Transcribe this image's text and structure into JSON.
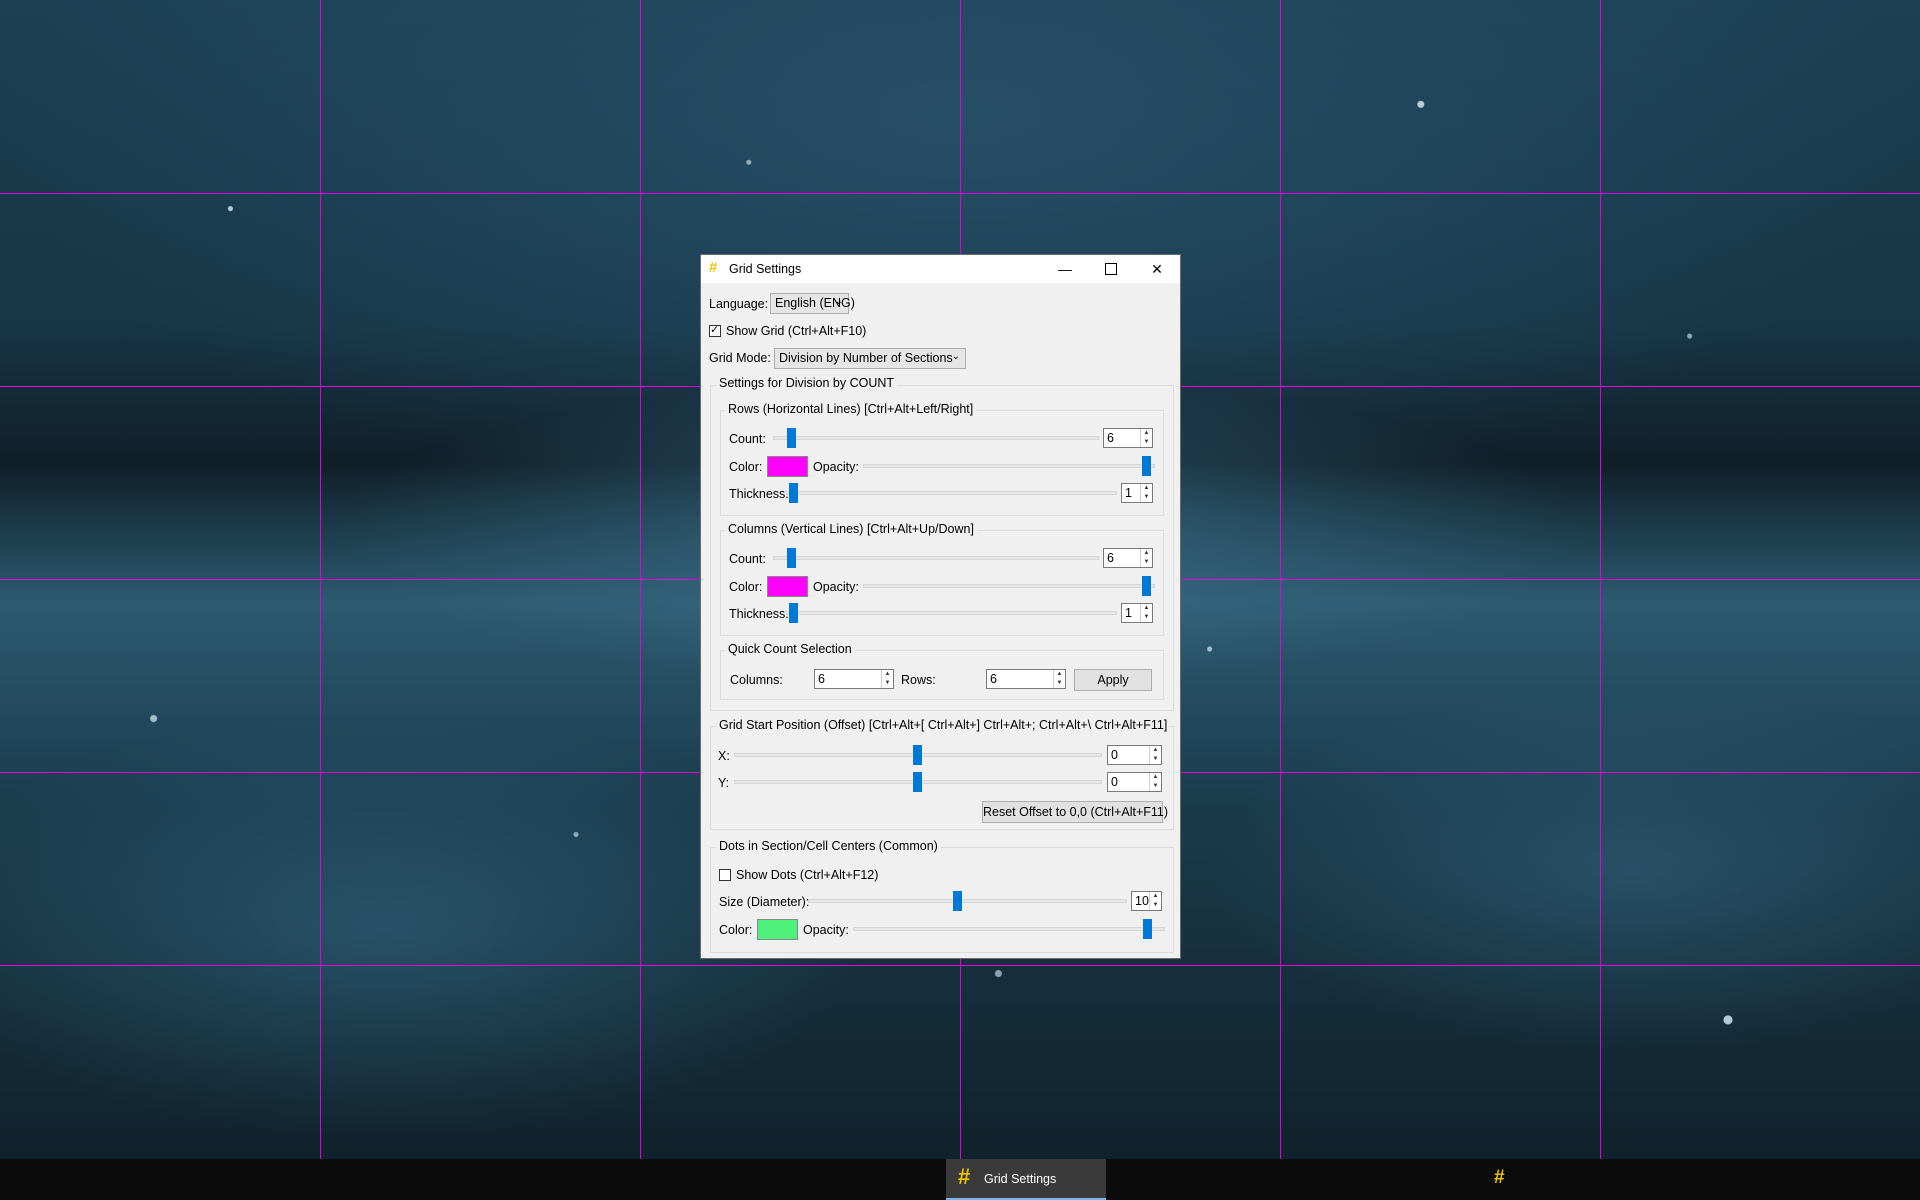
{
  "window": {
    "title": "Grid Settings",
    "language_label": "Language:",
    "language_value": "English (ENG)",
    "show_grid_label": "Show Grid (Ctrl+Alt+F10)",
    "show_grid_checked": true,
    "grid_mode_label": "Grid Mode:",
    "grid_mode_value": "Division by Number of Sections"
  },
  "count_settings": {
    "title": "Settings for Division by COUNT",
    "rows": {
      "title": "Rows (Horizontal Lines) [Ctrl+Alt+Left/Right]",
      "count_label": "Count:",
      "count_value": "6",
      "color_label": "Color:",
      "color": "#ff00ff",
      "opacity_label": "Opacity:",
      "opacity_level": 1.0,
      "thickness_label": "Thickness:",
      "thickness_value": "1"
    },
    "columns": {
      "title": "Columns (Vertical Lines) [Ctrl+Alt+Up/Down]",
      "count_label": "Count:",
      "count_value": "6",
      "color_label": "Color:",
      "color": "#ff00ff",
      "opacity_label": "Opacity:",
      "opacity_level": 1.0,
      "thickness_label": "Thickness:",
      "thickness_value": "1"
    },
    "quick": {
      "title": "Quick Count Selection",
      "columns_label": "Columns:",
      "columns_value": "6",
      "rows_label": "Rows:",
      "rows_value": "6",
      "apply_label": "Apply"
    }
  },
  "offset": {
    "title": "Grid Start Position (Offset) [Ctrl+Alt+[ Ctrl+Alt+] Ctrl+Alt+; Ctrl+Alt+\\ Ctrl+Alt+F11]",
    "x_label": "X:",
    "x_value": "0",
    "y_label": "Y:",
    "y_value": "0",
    "reset_label": "Reset Offset to 0,0 (Ctrl+Alt+F11)"
  },
  "dots": {
    "title": "Dots in Section/Cell Centers (Common)",
    "show_label": "Show Dots (Ctrl+Alt+F12)",
    "show_checked": false,
    "size_label": "Size (Diameter):",
    "size_value": "10",
    "color_label": "Color:",
    "color": "#4cf07a",
    "opacity_label": "Opacity:",
    "opacity_level": 1.0
  },
  "taskbar": {
    "item_label": "Grid Settings",
    "app_icon": "#",
    "tray_icon": "#"
  },
  "icons": {
    "minimize": "—",
    "close": "✕",
    "spin_up": "▲",
    "spin_down": "▼",
    "dropdown": "⌵"
  }
}
